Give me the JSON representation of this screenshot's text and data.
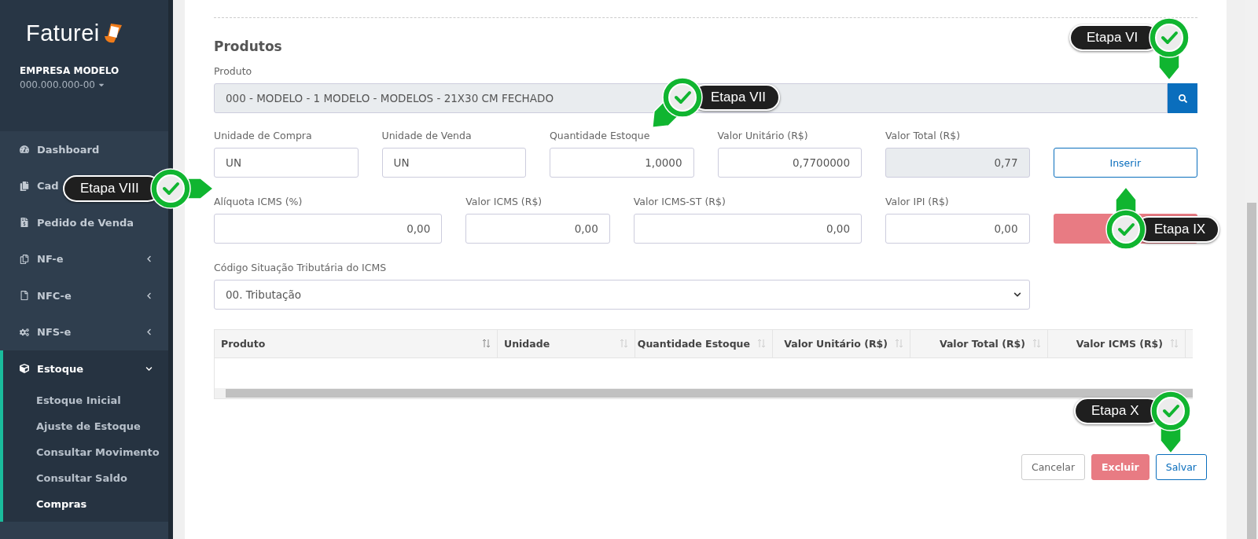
{
  "sidebar": {
    "logo": "Faturei",
    "company": "EMPRESA MODELO",
    "document": "000.000.000-00",
    "items": [
      {
        "label": "Dashboard",
        "selected": false
      },
      {
        "label": "Cad",
        "selected": false
      },
      {
        "label": "Pedido de Venda",
        "selected": false
      },
      {
        "label": "NF-e",
        "expanded": false,
        "selected": false
      },
      {
        "label": "NFC-e",
        "expanded": false,
        "selected": false
      },
      {
        "label": "NFS-e",
        "expanded": false,
        "selected": false
      },
      {
        "label": "Estoque",
        "expanded": true,
        "selected": true,
        "children": [
          {
            "label": "Estoque Inicial",
            "selected": false
          },
          {
            "label": "Ajuste de Estoque",
            "selected": false
          },
          {
            "label": "Consultar Movimento",
            "selected": false
          },
          {
            "label": "Consultar Saldo",
            "selected": false
          },
          {
            "label": "Compras",
            "selected": true
          }
        ]
      }
    ]
  },
  "section_title": "Produtos",
  "product": {
    "label": "Produto",
    "value": "000 - MODELO - 1 MODELO - MODELOS - 21X30 CM FECHADO"
  },
  "fields_row1": [
    {
      "label": "Unidade de Compra",
      "value": "UN",
      "readonly": false
    },
    {
      "label": "Unidade de Venda",
      "value": "UN",
      "readonly": false
    },
    {
      "label": "Quantidade Estoque",
      "value": "1,0000",
      "readonly": false
    },
    {
      "label": "Valor Unitário (R$)",
      "value": "0,7700000",
      "readonly": false
    },
    {
      "label": "Valor Total (R$)",
      "value": "0,77",
      "readonly": true
    }
  ],
  "insert_button": "Inserir",
  "fields_row2": [
    {
      "label": "Alíquota ICMS (%)",
      "value": "0,00"
    },
    {
      "label": "Valor ICMS (R$)",
      "value": "0,00"
    },
    {
      "label": "Valor ICMS-ST (R$)",
      "value": "0,00"
    },
    {
      "label": "Valor IPI (R$)",
      "value": "0,00"
    }
  ],
  "cst": {
    "label": "Código Situação Tributária do ICMS",
    "value": "00. Tributação"
  },
  "table": {
    "columns": [
      "Produto",
      "Unidade",
      "Quantidade Estoque",
      "Valor Unitário (R$)",
      "Valor Total (R$)",
      "Valor ICMS (R$)"
    ]
  },
  "buttons": [
    {
      "label": "Cancelar",
      "kind": "default"
    },
    {
      "label": "Excluir",
      "kind": "danger"
    },
    {
      "label": "Salvar",
      "kind": "primary"
    }
  ],
  "callouts": [
    {
      "label": "Etapa VI",
      "kind": "down"
    },
    {
      "label": "Etapa VII",
      "kind": "downleft"
    },
    {
      "label": "Etapa VIII",
      "kind": "right"
    },
    {
      "label": "Etapa IX",
      "kind": "up"
    },
    {
      "label": "Etapa X",
      "kind": "down"
    }
  ]
}
